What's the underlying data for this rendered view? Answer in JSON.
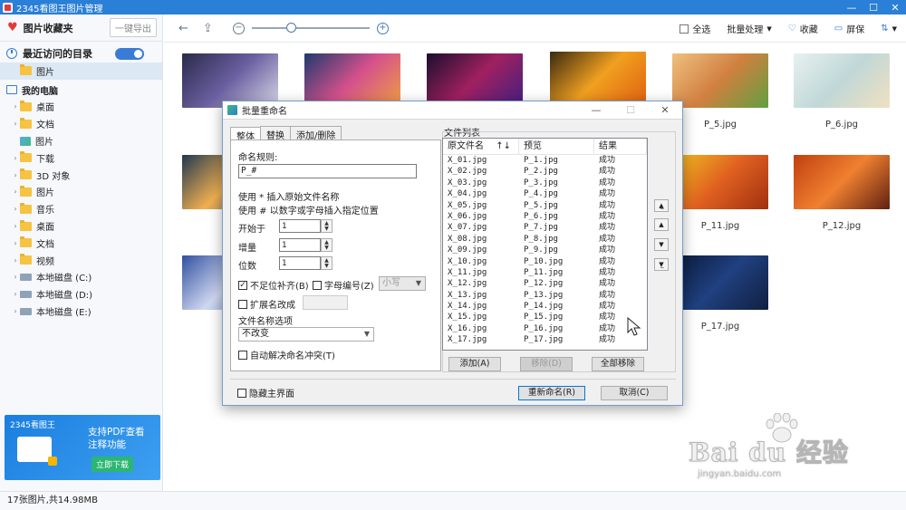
{
  "window": {
    "title": "2345看图王图片管理"
  },
  "sidebar": {
    "favorites_label": "图片收藏夹",
    "export_label": "一键导出",
    "recent_label": "最近访问的目录",
    "recent_items": [
      "图片"
    ],
    "my_pc_label": "我的电脑",
    "tree": [
      {
        "label": "桌面",
        "type": "folder"
      },
      {
        "label": "文档",
        "type": "folder"
      },
      {
        "label": "图片",
        "type": "image"
      },
      {
        "label": "下载",
        "type": "folder"
      },
      {
        "label": "3D 对象",
        "type": "folder"
      },
      {
        "label": "图片",
        "type": "folder"
      },
      {
        "label": "音乐",
        "type": "folder"
      },
      {
        "label": "桌面",
        "type": "folder"
      },
      {
        "label": "文档",
        "type": "folder"
      },
      {
        "label": "视频",
        "type": "folder"
      },
      {
        "label": "本地磁盘 (C:)",
        "type": "drive"
      },
      {
        "label": "本地磁盘 (D:)",
        "type": "drive"
      },
      {
        "label": "本地磁盘 (E:)",
        "type": "drive"
      }
    ],
    "ad": {
      "brand": "2345看图王",
      "text": "支持PDF查看\n注释功能",
      "button": "立即下载"
    }
  },
  "toolbar": {
    "select_all": "全选",
    "batch": "批量处理",
    "favorite": "收藏",
    "screen": "屏保"
  },
  "thumbnails": [
    {
      "label": "",
      "colors": [
        "#2b2a4a",
        "#6a5fa0",
        "#d8d8e8"
      ]
    },
    {
      "label": "",
      "colors": [
        "#1e3a6e",
        "#d4508c",
        "#f0a040"
      ]
    },
    {
      "label": "",
      "colors": [
        "#1a0f2e",
        "#a02060",
        "#402080"
      ]
    },
    {
      "label": "",
      "colors": [
        "#3a2a10",
        "#f0a020",
        "#e06010"
      ]
    },
    {
      "label": "P_5.jpg",
      "colors": [
        "#f0c080",
        "#d08040",
        "#60a040"
      ]
    },
    {
      "label": "P_6.jpg",
      "colors": [
        "#e8f0f0",
        "#c0d8d8",
        "#f0e0c0"
      ]
    },
    {
      "label": "",
      "colors": [
        "#203850",
        "#f0b050",
        "#406080"
      ]
    },
    {
      "label": "P_11.jpg",
      "colors": [
        "#f0c020",
        "#e06020",
        "#a03010"
      ]
    },
    {
      "label": "P_12.jpg",
      "colors": [
        "#c04010",
        "#f08030",
        "#602010"
      ]
    },
    {
      "label": "",
      "colors": [
        "#3050a0",
        "#d0d8f0",
        "#6080c0"
      ]
    },
    {
      "label": "P_17.jpg",
      "colors": [
        "#0a1a3a",
        "#204080",
        "#102040"
      ]
    }
  ],
  "status": {
    "text": "17张图片,共14.98MB"
  },
  "dialog": {
    "title": "批量重命名",
    "tabs": [
      "整体",
      "替换",
      "添加/删除"
    ],
    "rule_label": "命名规则:",
    "rule_value": "P_#",
    "hint1": "使用 * 插入原始文件名称",
    "hint2": "使用 # 以数字或字母插入指定位置",
    "start_label": "开始于",
    "start_value": "1",
    "increment_label": "增量",
    "increment_value": "1",
    "digits_label": "位数",
    "digits_value": "1",
    "pad_label": "不足位补齐(B)",
    "letter_label": "字母编号(Z)",
    "case_value": "小写",
    "ext_label": "扩展名改成",
    "name_opt_label": "文件名称选项",
    "name_opt_value": "不改变",
    "auto_resolve_label": "自动解决命名冲突(T)",
    "hide_main_label": "隐藏主界面",
    "file_list_label": "文件列表",
    "columns": [
      "原文件名",
      "预览",
      "结果"
    ],
    "files": [
      [
        "X_01.jpg",
        "P_1.jpg",
        "成功"
      ],
      [
        "X_02.jpg",
        "P_2.jpg",
        "成功"
      ],
      [
        "X_03.jpg",
        "P_3.jpg",
        "成功"
      ],
      [
        "X_04.jpg",
        "P_4.jpg",
        "成功"
      ],
      [
        "X_05.jpg",
        "P_5.jpg",
        "成功"
      ],
      [
        "X_06.jpg",
        "P_6.jpg",
        "成功"
      ],
      [
        "X_07.jpg",
        "P_7.jpg",
        "成功"
      ],
      [
        "X_08.jpg",
        "P_8.jpg",
        "成功"
      ],
      [
        "X_09.jpg",
        "P_9.jpg",
        "成功"
      ],
      [
        "X_10.jpg",
        "P_10.jpg",
        "成功"
      ],
      [
        "X_11.jpg",
        "P_11.jpg",
        "成功"
      ],
      [
        "X_12.jpg",
        "P_12.jpg",
        "成功"
      ],
      [
        "X_13.jpg",
        "P_13.jpg",
        "成功"
      ],
      [
        "X_14.jpg",
        "P_14.jpg",
        "成功"
      ],
      [
        "X_15.jpg",
        "P_15.jpg",
        "成功"
      ],
      [
        "X_16.jpg",
        "P_16.jpg",
        "成功"
      ],
      [
        "X_17.jpg",
        "P_17.jpg",
        "成功"
      ]
    ],
    "add_label": "添加(A)",
    "remove_label": "移除(D)",
    "remove_all_label": "全部移除",
    "rename_label": "重新命名(R)",
    "cancel_label": "取消(C)"
  },
  "watermark": {
    "main": "Bai du 经验",
    "url": "jingyan.baidu.com"
  }
}
